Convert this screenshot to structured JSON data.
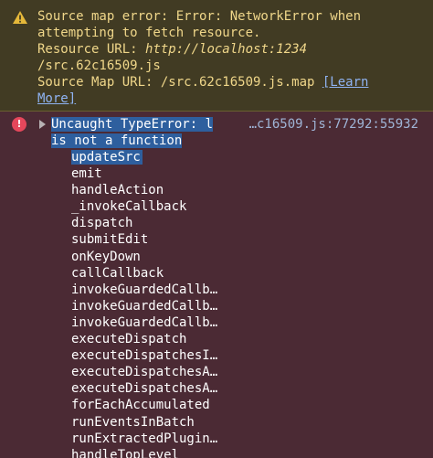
{
  "warning": {
    "icon": "warning-triangle-icon",
    "line1": "Source map error: Error: NetworkError when",
    "line2": "attempting to fetch resource.",
    "resource_label": "Resource URL: ",
    "resource_url_part1": "http://localhost:1234",
    "resource_url_part2": "/src.62c16509.js",
    "sourcemap_label": "Source Map URL: /src.62c16509.js.map ",
    "learn_more_part1": "[Learn",
    "learn_more_part2": "More]",
    "color": "#f0d78a",
    "background": "#413b23"
  },
  "error": {
    "icon": "error-circle-icon",
    "icon_glyph": "!",
    "message_line1": "Uncaught TypeError: l",
    "message_line2": "is not a function",
    "source_link": "…c16509.js:77292:55932",
    "background": "#4b2a34",
    "selection_color": "#2e5f9e",
    "stack": [
      "updateSrc",
      "emit",
      "handleAction",
      "_invokeCallback",
      "dispatch",
      "submitEdit",
      "onKeyDown",
      "callCallback",
      "invokeGuardedCallb…",
      "invokeGuardedCallb…",
      "invokeGuardedCallb…",
      "executeDispatch",
      "executeDispatchesI…",
      "executeDispatchesA…",
      "executeDispatchesA…",
      "forEachAccumulated",
      "runEventsInBatch",
      "runExtractedPlugin…",
      "handleTopLevel"
    ]
  }
}
